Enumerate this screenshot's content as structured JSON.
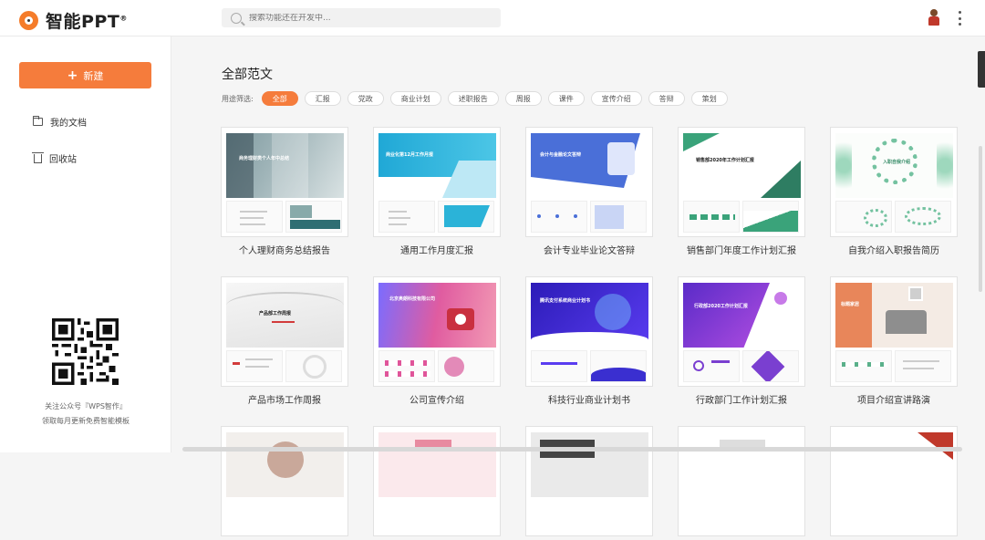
{
  "app": {
    "name": "智能PPT",
    "mark": "®"
  },
  "search": {
    "placeholder": "搜索功能还在开发中..."
  },
  "sidebar": {
    "new_label": "新建",
    "items": [
      {
        "label": "我的文档",
        "icon": "folder-icon"
      },
      {
        "label": "回收站",
        "icon": "trash-icon"
      }
    ],
    "qr_caption_1": "关注公众号『WPS智作』",
    "qr_caption_2": "领取每月更新免费智能模板"
  },
  "main": {
    "title": "全部范文",
    "filter_label": "用途筛选:",
    "filters": [
      "全部",
      "汇报",
      "党政",
      "商业计划",
      "述职报告",
      "周报",
      "课件",
      "宣传介绍",
      "答辩",
      "策划"
    ],
    "active_filter": "全部"
  },
  "templates": [
    {
      "title": "个人理财商务总结报告",
      "slide_text": "商务理财类个人年中总结",
      "accent": "#2f6e73"
    },
    {
      "title": "通用工作月度汇报",
      "slide_text": "商业化第12月工作月报",
      "accent": "#2bb3d8"
    },
    {
      "title": "会计专业毕业论文答辩",
      "slide_text": "会计与金融论文答辩",
      "accent": "#4a6fd8"
    },
    {
      "title": "销售部门年度工作计划汇报",
      "slide_text": "销售部2020年工作计划汇报",
      "accent": "#3aa37a"
    },
    {
      "title": "自我介绍入职报告简历",
      "slide_text": "入职自我介绍",
      "accent": "#5bb08a"
    },
    {
      "title": "产品市场工作周报",
      "slide_text": "产品部工作周报",
      "accent": "#d23b3b"
    },
    {
      "title": "公司宣传介绍",
      "slide_text": "北京奥朗科技有限公司",
      "accent": "#e0559a"
    },
    {
      "title": "科技行业商业计划书",
      "slide_text": "腾讯支付系统商业计划书",
      "accent": "#3a2fd0"
    },
    {
      "title": "行政部门工作计划汇报",
      "slide_text": "行政部2020工作计划汇报",
      "accent": "#7a3fd0"
    },
    {
      "title": "项目介绍宣讲路演",
      "slide_text": "标题家居",
      "accent": "#e8865a"
    }
  ],
  "colors": {
    "brand": "#f57c3c"
  }
}
